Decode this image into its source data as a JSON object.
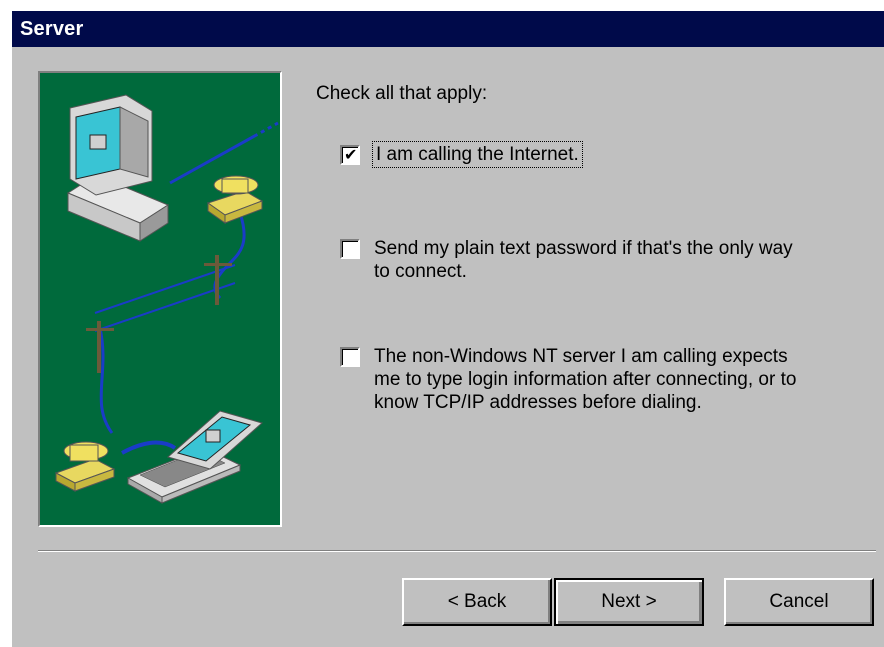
{
  "window": {
    "title": "Server"
  },
  "main": {
    "prompt": "Check all that apply:",
    "options": [
      {
        "label": "I am calling the Internet.",
        "checked": true
      },
      {
        "label": "Send my plain text password if that's the only way\nto connect.",
        "checked": false
      },
      {
        "label": "The non-Windows NT server I am calling expects\nme to type login information after connecting, or to\nknow TCP/IP addresses before dialing.",
        "checked": false
      }
    ]
  },
  "buttons": {
    "back": "< Back",
    "next": "Next >",
    "cancel": "Cancel"
  },
  "colors": {
    "titlebar": "#000a4a",
    "illustration_bg": "#006a3c",
    "dialog_bg": "#c0c0c0"
  }
}
